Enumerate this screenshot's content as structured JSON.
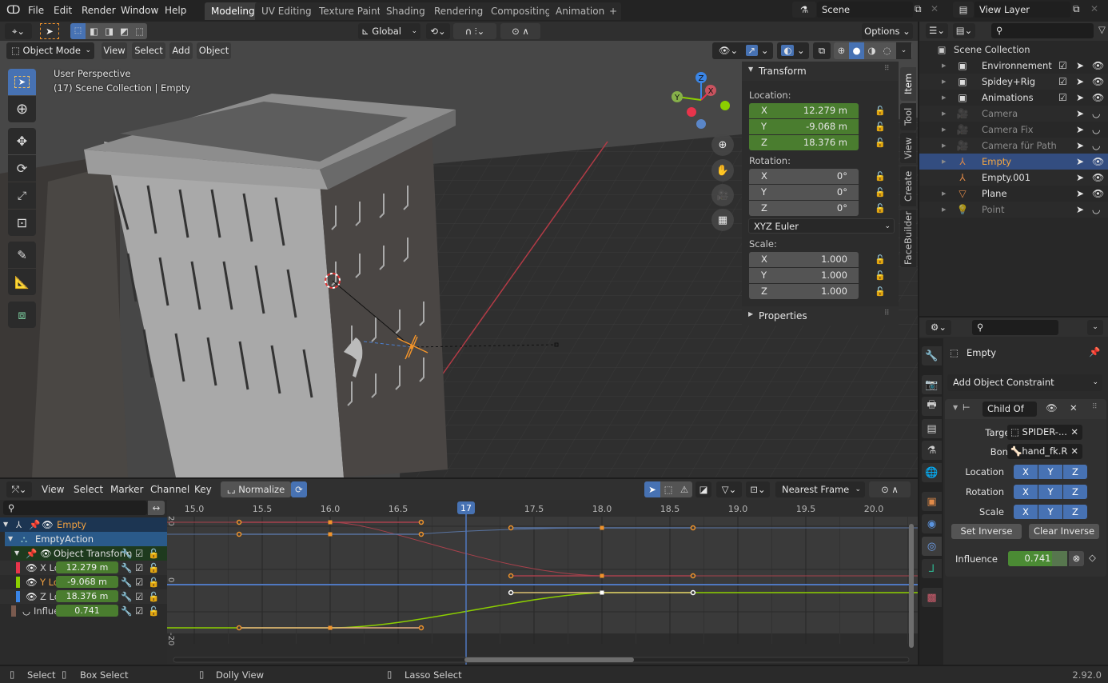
{
  "app": {
    "version": "2.92.0"
  },
  "topbar": {
    "menus": [
      "File",
      "Edit",
      "Render",
      "Window",
      "Help"
    ],
    "workspaces": [
      "Modeling",
      "UV Editing",
      "Texture Paint",
      "Shading",
      "Rendering",
      "Compositing",
      "Animation"
    ],
    "active_workspace": "Modeling",
    "add_workspace": "+",
    "scene": "Scene",
    "view_layer": "View Layer"
  },
  "tool_header": {
    "orientation": "Global",
    "options": "Options"
  },
  "viewport_header": {
    "mode": "Object Mode",
    "menus": [
      "View",
      "Select",
      "Add",
      "Object"
    ]
  },
  "viewport": {
    "perspective": "User Perspective",
    "context": "(17) Scene Collection | Empty",
    "gizmo": {
      "z": "Z",
      "y": "Y",
      "x": "X"
    }
  },
  "npanel": {
    "tabs": [
      "Item",
      "Tool",
      "View",
      "Create",
      "FaceBuilder"
    ],
    "active_tab": "Item",
    "transform_title": "Transform",
    "location_label": "Location:",
    "location": [
      {
        "axis": "X",
        "value": "12.279 m"
      },
      {
        "axis": "Y",
        "value": "-9.068 m"
      },
      {
        "axis": "Z",
        "value": "18.376 m"
      }
    ],
    "rotation_label": "Rotation:",
    "rotation": [
      {
        "axis": "X",
        "value": "0°"
      },
      {
        "axis": "Y",
        "value": "0°"
      },
      {
        "axis": "Z",
        "value": "0°"
      }
    ],
    "rotation_mode": "XYZ Euler",
    "scale_label": "Scale:",
    "scale": [
      {
        "axis": "X",
        "value": "1.000"
      },
      {
        "axis": "Y",
        "value": "1.000"
      },
      {
        "axis": "Z",
        "value": "1.000"
      }
    ],
    "properties_title": "Properties"
  },
  "outliner": {
    "root": "Scene Collection",
    "items": [
      {
        "name": "Environnement",
        "type": "collection",
        "selected": false,
        "dim": false
      },
      {
        "name": "Spidey+Rig",
        "type": "collection",
        "selected": false,
        "dim": false
      },
      {
        "name": "Animations",
        "type": "collection",
        "selected": false,
        "dim": false
      },
      {
        "name": "Camera",
        "type": "camera",
        "selected": false,
        "dim": true
      },
      {
        "name": "Camera Fix",
        "type": "camera",
        "selected": false,
        "dim": true
      },
      {
        "name": "Camera für Path",
        "type": "camera",
        "selected": false,
        "dim": true
      },
      {
        "name": "Empty",
        "type": "empty",
        "selected": true,
        "dim": false
      },
      {
        "name": "Empty.001",
        "type": "empty",
        "selected": false,
        "dim": false
      },
      {
        "name": "Plane",
        "type": "mesh",
        "selected": false,
        "dim": false
      },
      {
        "name": "Point",
        "type": "light",
        "selected": false,
        "dim": true
      }
    ]
  },
  "properties": {
    "object_name": "Empty",
    "add_constraint": "Add Object Constraint",
    "constraint": {
      "name": "Child Of",
      "target_label": "Target",
      "target": "SPIDER-...",
      "bone_label": "Bone",
      "bone": "hand_fk.R",
      "location_label": "Location",
      "rotation_label": "Rotation",
      "scale_label": "Scale",
      "axes": [
        "X",
        "Y",
        "Z"
      ],
      "set_inverse": "Set Inverse",
      "clear_inverse": "Clear Inverse",
      "influence_label": "Influence",
      "influence": "0.741",
      "influence_fraction": 0.741
    }
  },
  "graph_editor": {
    "menus": [
      "View",
      "Select",
      "Marker",
      "Channel",
      "Key"
    ],
    "normalize": "Normalize",
    "snap_mode": "Nearest Frame",
    "current_frame": "17",
    "frame_ticks": [
      "15.0",
      "15.5",
      "16.0",
      "16.5",
      "17.5",
      "18.0",
      "18.5",
      "19.0",
      "19.5",
      "20.0"
    ],
    "value_ticks": [
      "20",
      "0",
      "-20"
    ],
    "channels": [
      {
        "name": "Empty",
        "kind": "object"
      },
      {
        "name": "EmptyAction",
        "kind": "action"
      },
      {
        "name": "Object Transform",
        "kind": "group"
      },
      {
        "name": "X Lo",
        "value": "12.279 m",
        "color": "#e8344b"
      },
      {
        "name": "Y Lo",
        "value": "-9.068 m",
        "color": "#8ccf00"
      },
      {
        "name": "Z Lo",
        "value": "18.376 m",
        "color": "#3a85e6"
      },
      {
        "name": "Influe",
        "value": "0.741",
        "color": "#7a5a4e"
      }
    ]
  },
  "statusbar": {
    "items": [
      "Select",
      "Box Select",
      "Dolly View",
      "Lasso Select"
    ],
    "version": "2.92.0"
  }
}
